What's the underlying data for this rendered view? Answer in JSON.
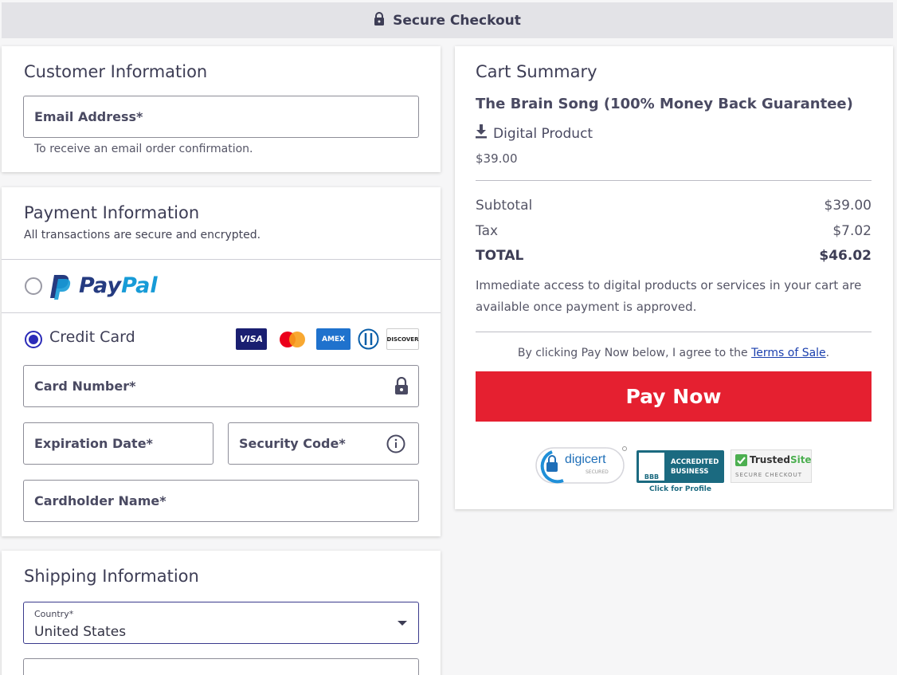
{
  "header": {
    "title": "Secure Checkout"
  },
  "customer": {
    "title": "Customer Information",
    "email_label": "Email Address*",
    "email_helper": "To receive an email order confirmation."
  },
  "payment": {
    "title": "Payment Information",
    "subtitle": "All transactions are secure and encrypted.",
    "paypal_part1": "Pay",
    "paypal_part2": "Pal",
    "credit_card_label": "Credit Card",
    "card_brands": [
      "VISA",
      "AMEX",
      "DISCOVER"
    ],
    "card_number_label": "Card Number*",
    "expiration_label": "Expiration Date*",
    "security_code_label": "Security Code*",
    "cardholder_label": "Cardholder Name*"
  },
  "shipping": {
    "title": "Shipping Information",
    "country_label": "Country*",
    "country_value": "United States"
  },
  "cart": {
    "title": "Cart Summary",
    "product_name": "The Brain Song (100% Money Back Guarantee)",
    "product_type": "Digital Product",
    "product_price": "$39.00",
    "subtotal_label": "Subtotal",
    "subtotal_value": "$39.00",
    "tax_label": "Tax",
    "tax_value": "$7.02",
    "total_label": "TOTAL",
    "total_value": "$46.02",
    "access_note": "Immediate access to digital products or services in your cart are available once payment is approved.",
    "agree_prefix": "By clicking Pay Now below, I agree to the ",
    "terms_link": "Terms of Sale",
    "agree_suffix": ".",
    "pay_button": "Pay Now"
  },
  "badges": {
    "digicert_name": "digicert",
    "digicert_sub": "SECURED",
    "bbb_line1": "ACCREDITED",
    "bbb_line2": "BUSINESS",
    "bbb_mark": "BBB",
    "bbb_link": "Click for Profile",
    "trusted_part1": "Trusted",
    "trusted_part2": "Site",
    "trusted_sub": "SECURE CHECKOUT"
  },
  "colors": {
    "pay_button": "#e52030",
    "radio_selected": "#2b2bb8",
    "paypal_dark": "#253b80",
    "paypal_light": "#179bd7",
    "bbb_teal": "#1b6a80"
  },
  "icons": [
    "lock-icon",
    "download-icon",
    "info-icon",
    "paypal-logo",
    "visa-logo",
    "mastercard-logo",
    "amex-logo",
    "diners-logo",
    "discover-logo"
  ]
}
